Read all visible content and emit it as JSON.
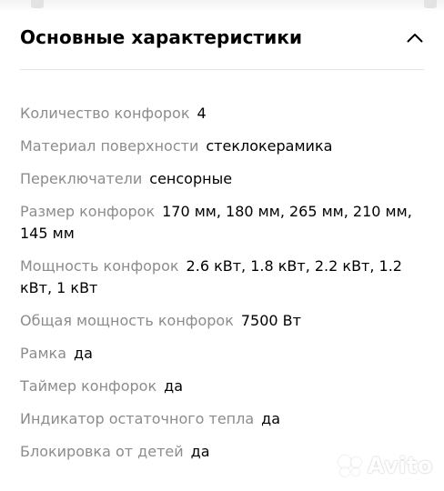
{
  "section": {
    "title": "Основные характеристики"
  },
  "specs": [
    {
      "label": "Количество конфорок",
      "value": "4"
    },
    {
      "label": "Материал поверхности",
      "value": "стеклокерамика"
    },
    {
      "label": "Переключатели",
      "value": "сенсорные"
    },
    {
      "label": "Размер конфорок",
      "value": "170 мм, 180 мм, 265 мм, 210 мм, 145 мм"
    },
    {
      "label": "Мощность конфорок",
      "value": "2.6 кВт, 1.8 кВт, 2.2 кВт, 1.2 кВт, 1 кВт"
    },
    {
      "label": "Общая мощность конфорок",
      "value": "7500 Вт"
    },
    {
      "label": "Рамка",
      "value": "да"
    },
    {
      "label": "Таймер конфорок",
      "value": "да"
    },
    {
      "label": "Индикатор остаточного тепла",
      "value": "да"
    },
    {
      "label": "Блокировка от детей",
      "value": "да"
    }
  ],
  "watermark": {
    "text": "Avito"
  },
  "icons": {
    "collapse": "chevron-up-icon",
    "watermark_logo": "avito-logo-icon"
  }
}
